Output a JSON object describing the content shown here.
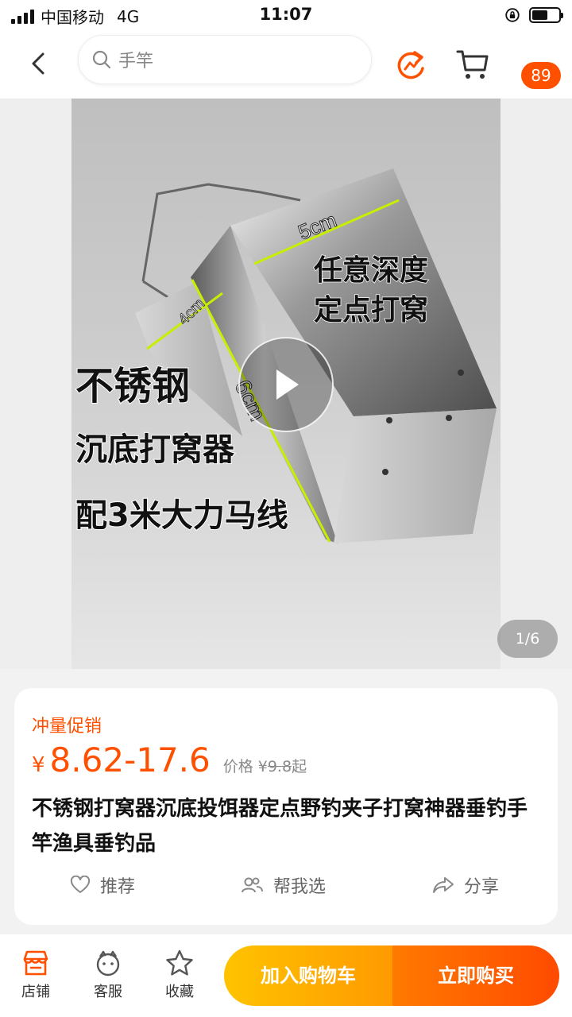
{
  "status_bar": {
    "carrier": "中国移动",
    "network": "4G",
    "time": "11:07"
  },
  "header": {
    "search_text": "手竿",
    "more_badge": "89",
    "icons": [
      "back-arrow-icon",
      "search-icon",
      "share-icon",
      "cart-icon",
      "more-icon"
    ]
  },
  "media": {
    "image_text": {
      "dim_top": "5cm",
      "dim_side": "4cm",
      "dim_height": "6cm",
      "caption_right_1": "任意深度",
      "caption_right_2": "定点打窝",
      "caption_left_1": "不锈钢",
      "caption_left_2": "沉底打窝器",
      "caption_left_3": "配3米大力马线"
    },
    "page_indicator": "1/6"
  },
  "product": {
    "promo_label": "冲量促销",
    "currency": "¥",
    "price": "8.62-17.6",
    "original_label": "价格",
    "original_currency": "¥",
    "original_price": "9.8",
    "original_suffix": "起",
    "title": "不锈钢打窝器沉底投饵器定点野钓夹子打窝神器垂钓手竿渔具垂钓品",
    "actions": {
      "recommend": "推荐",
      "help_choose": "帮我选",
      "share": "分享"
    }
  },
  "bottom_bar": {
    "store": "店铺",
    "service": "客服",
    "favorite": "收藏",
    "add_to_cart": "加入购物车",
    "buy_now": "立即购买"
  },
  "colors": {
    "accent": "#ff5000",
    "cart_button": "#ffb000",
    "buy_button": "#ff5a00"
  }
}
